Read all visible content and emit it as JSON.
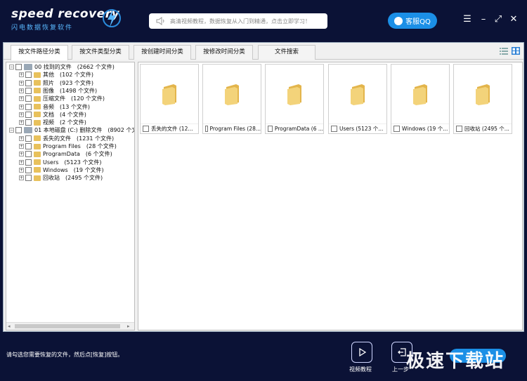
{
  "app": {
    "logo_name": "speed recovery",
    "logo_sub": "闪电数据恢复软件",
    "notice": "高清视频教程，数据恢复从入门到精通，点击立即学习！",
    "support_button": "客服QQ",
    "window_controls": [
      "☰",
      "–",
      "⤢",
      "✕"
    ]
  },
  "tabs": [
    {
      "label": "按文件路径分类",
      "active": true
    },
    {
      "label": "按文件类型分类",
      "active": false
    },
    {
      "label": "按创建时间分类",
      "active": false
    },
    {
      "label": "按修改时间分类",
      "active": false
    },
    {
      "label": "文件搜索",
      "active": false
    }
  ],
  "tree": [
    {
      "level": 0,
      "type": "drive",
      "label": "00 找到的文件",
      "count": "(2662 个文件)"
    },
    {
      "level": 1,
      "type": "folder",
      "label": "其他",
      "count": "(102 个文件)"
    },
    {
      "level": 1,
      "type": "folder",
      "label": "照片",
      "count": "(923 个文件)"
    },
    {
      "level": 1,
      "type": "folder",
      "label": "图像",
      "count": "(1498 个文件)"
    },
    {
      "level": 1,
      "type": "folder",
      "label": "压缩文件",
      "count": "(120 个文件)"
    },
    {
      "level": 1,
      "type": "folder",
      "label": "音频",
      "count": "(13 个文件)"
    },
    {
      "level": 1,
      "type": "folder",
      "label": "文档",
      "count": "(4 个文件)"
    },
    {
      "level": 1,
      "type": "folder",
      "label": "视频",
      "count": "(2 个文件)"
    },
    {
      "level": 0,
      "type": "drive",
      "label": "01 本地磁盘 (C:) 删除文件",
      "count": "(8902 个文("
    },
    {
      "level": 1,
      "type": "folder",
      "label": "丢失的文件",
      "count": "(1231 个文件)"
    },
    {
      "level": 1,
      "type": "folder",
      "label": "Program Files",
      "count": "(28 个文件)"
    },
    {
      "level": 1,
      "type": "folder",
      "label": "ProgramData",
      "count": "(6 个文件)"
    },
    {
      "level": 1,
      "type": "folder",
      "label": "Users",
      "count": "(5123 个文件)"
    },
    {
      "level": 1,
      "type": "folder",
      "label": "Windows",
      "count": "(19 个文件)"
    },
    {
      "level": 1,
      "type": "folder",
      "label": "回收站",
      "count": "(2495 个文件)"
    }
  ],
  "tiles": [
    {
      "label": "丢失的文件 (12..."
    },
    {
      "label": "Program Files (28..."
    },
    {
      "label": "ProgramData (6 ..."
    },
    {
      "label": "Users (5123 个..."
    },
    {
      "label": "Windows (19 个..."
    },
    {
      "label": "回收站 (2495 个..."
    }
  ],
  "footer": {
    "status": "请勾选您需要恢复的文件，然后点[恢复]按钮。",
    "video_label": "视频教程",
    "prev_label": "上一步",
    "watermark": "极速下载站"
  },
  "colors": {
    "background": "#0b1236",
    "accent": "#1b8fe6",
    "folder": "#e8c15c"
  }
}
